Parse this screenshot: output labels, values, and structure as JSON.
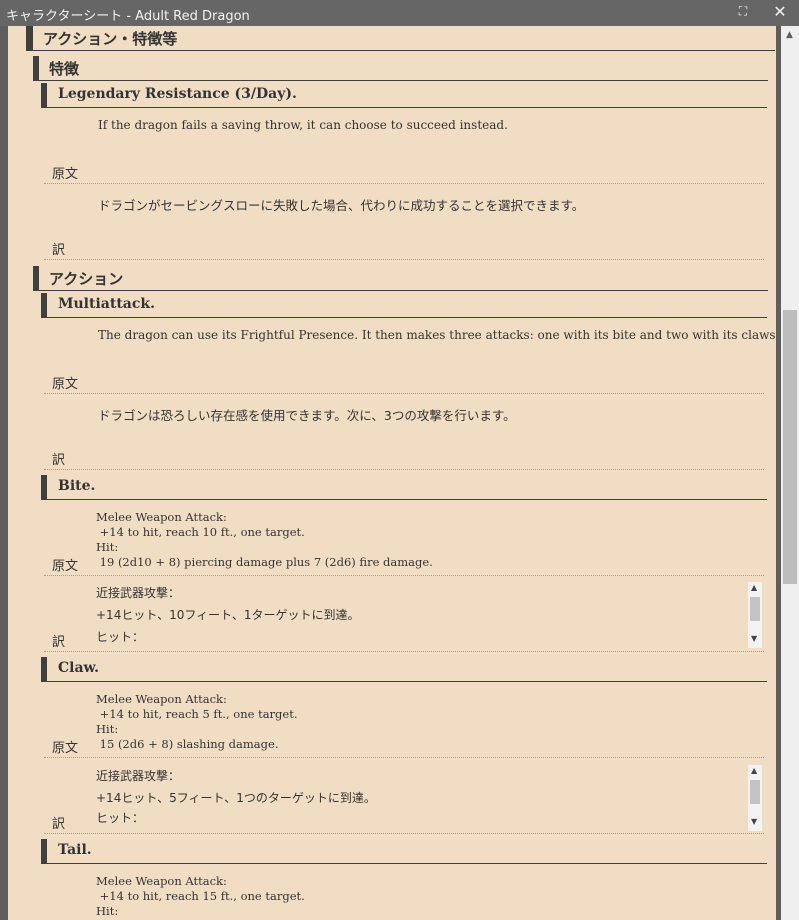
{
  "window": {
    "title": "キャラクターシート - Adult Red Dragon",
    "maximize_icon": "⛶",
    "close_icon": "✕"
  },
  "section": {
    "title": "アクション・特徴等"
  },
  "labels": {
    "original": "原文",
    "translation": "訳"
  },
  "traits": {
    "title": "特徴",
    "items": [
      {
        "name": "Legendary Resistance (3/Day).",
        "original": "If the dragon fails a saving throw, it can choose to succeed instead.",
        "translation": "ドラゴンがセービングスローに失敗した場合、代わりに成功することを選択できます。"
      }
    ]
  },
  "actions": {
    "title": "アクション",
    "items": [
      {
        "name": "Multiattack.",
        "original": "The dragon can use its Frightful Presence. It then makes three attacks: one with its bite and two with its claws.",
        "translation": "ドラゴンは恐ろしい存在感を使用できます。次に、3つの攻撃を行います。"
      },
      {
        "name": "Bite.",
        "original": "Melee Weapon Attack:\n +14 to hit, reach 10 ft., one target.\nHit:\n 19 (2d10 + 8) piercing damage plus 7 (2d6) fire damage.",
        "translation_lines": [
          "近接武器攻撃：",
          " +14ヒット、10フィート、1ターゲットに到達。",
          "ヒット："
        ]
      },
      {
        "name": "Claw.",
        "original": "Melee Weapon Attack:\n +14 to hit, reach 5 ft., one target.\nHit:\n 15 (2d6 + 8) slashing damage.",
        "translation_lines": [
          "近接武器攻撃：",
          " +14ヒット、5フィート、1つのターゲットに到達。",
          "ヒット："
        ]
      },
      {
        "name": "Tail.",
        "original": "Melee Weapon Attack:\n +14 to hit, reach 15 ft., one target.\nHit:"
      }
    ]
  }
}
